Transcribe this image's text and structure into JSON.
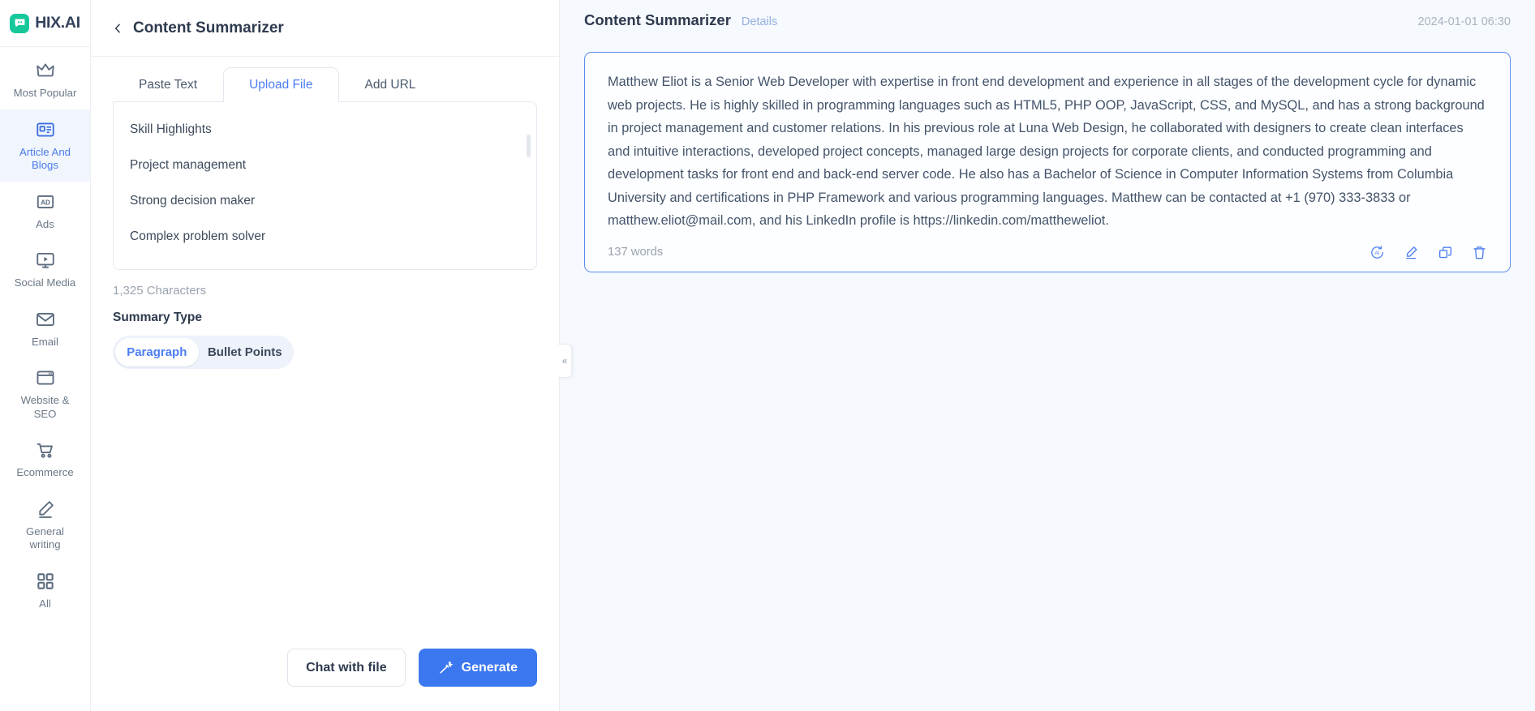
{
  "brand": {
    "name": "HIX.AI",
    "logo_icon": "chat-bubble-icon",
    "accent": "#16c79a"
  },
  "sidebar": {
    "items": [
      {
        "label": "Most Popular",
        "icon": "crown-icon",
        "active": false
      },
      {
        "label": "Article And Blogs",
        "icon": "article-icon",
        "active": true
      },
      {
        "label": "Ads",
        "icon": "ad-badge-icon",
        "active": false
      },
      {
        "label": "Social Media",
        "icon": "monitor-play-icon",
        "active": false
      },
      {
        "label": "Email",
        "icon": "envelope-icon",
        "active": false
      },
      {
        "label": "Website & SEO",
        "icon": "browser-window-icon",
        "active": false
      },
      {
        "label": "Ecommerce",
        "icon": "shopping-cart-icon",
        "active": false
      },
      {
        "label": "General writing",
        "icon": "pencil-icon",
        "active": false
      },
      {
        "label": "All",
        "icon": "grid-icon",
        "active": false
      }
    ]
  },
  "panel": {
    "back_icon": "chevron-left-icon",
    "title": "Content Summarizer",
    "tabs": [
      {
        "label": "Paste Text",
        "active": false
      },
      {
        "label": "Upload File",
        "active": true
      },
      {
        "label": "Add URL",
        "active": false
      }
    ],
    "file_lines": [
      "Skill Highlights",
      "Project management",
      "Strong decision maker",
      "Complex problem solver"
    ],
    "character_count": "1,325 Characters",
    "summary_type_label": "Summary Type",
    "summary_type_options": [
      {
        "label": "Paragraph",
        "selected": true
      },
      {
        "label": "Bullet Points",
        "selected": false
      }
    ],
    "chat_button": "Chat with file",
    "generate_button": "Generate",
    "generate_icon": "magic-wand-icon",
    "collapse_icon": "double-chevron-left-icon",
    "accent": "#3b78f0"
  },
  "result": {
    "title": "Content Summarizer",
    "details_link": "Details",
    "timestamp": "2024-01-01 06:30",
    "summary_text": "Matthew Eliot is a Senior Web Developer with expertise in front end development and experience in all stages of the development cycle for dynamic web projects. He is highly skilled in programming languages such as HTML5, PHP OOP, JavaScript, CSS, and MySQL, and has a strong background in project management and customer relations. In his previous role at Luna Web Design, he collaborated with designers to create clean interfaces and intuitive interactions, developed project concepts, managed large design projects for corporate clients, and conducted programming and development tasks for front end and back-end server code. He also has a Bachelor of Science in Computer Information Systems from Columbia University and certifications in PHP Framework and various programming languages. Matthew can be contacted at +1 (970) 333-3833 or matthew.eliot@mail.com, and his LinkedIn profile is https://linkedin.com/mattheweliot.",
    "word_count": "137 words",
    "actions": [
      {
        "name": "ai-rewrite-icon"
      },
      {
        "name": "edit-pencil-icon"
      },
      {
        "name": "copy-icon"
      },
      {
        "name": "delete-trash-icon"
      }
    ],
    "card_border_color": "#5b8def"
  }
}
